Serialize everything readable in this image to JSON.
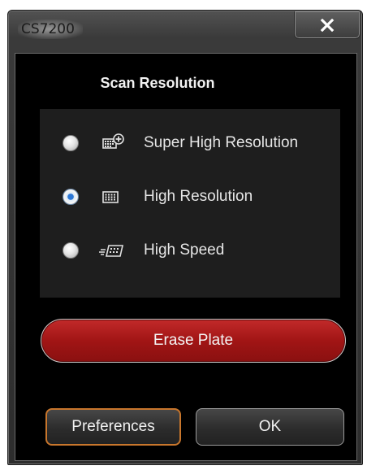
{
  "window": {
    "title": "CS7200",
    "close_icon": "close-x-icon"
  },
  "scan_resolution": {
    "title": "Scan Resolution",
    "options": [
      {
        "label": "Super High Resolution",
        "icon": "super-high-resolution-icon",
        "checked": false
      },
      {
        "label": "High Resolution",
        "icon": "high-resolution-icon",
        "checked": true
      },
      {
        "label": "High Speed",
        "icon": "high-speed-icon",
        "checked": false
      }
    ]
  },
  "buttons": {
    "erase": "Erase Plate",
    "preferences": "Preferences",
    "ok": "OK"
  },
  "colors": {
    "erase_red": "#a11515",
    "preferences_focus_border": "#c8762c",
    "radio_selected": "#2b77d6"
  }
}
